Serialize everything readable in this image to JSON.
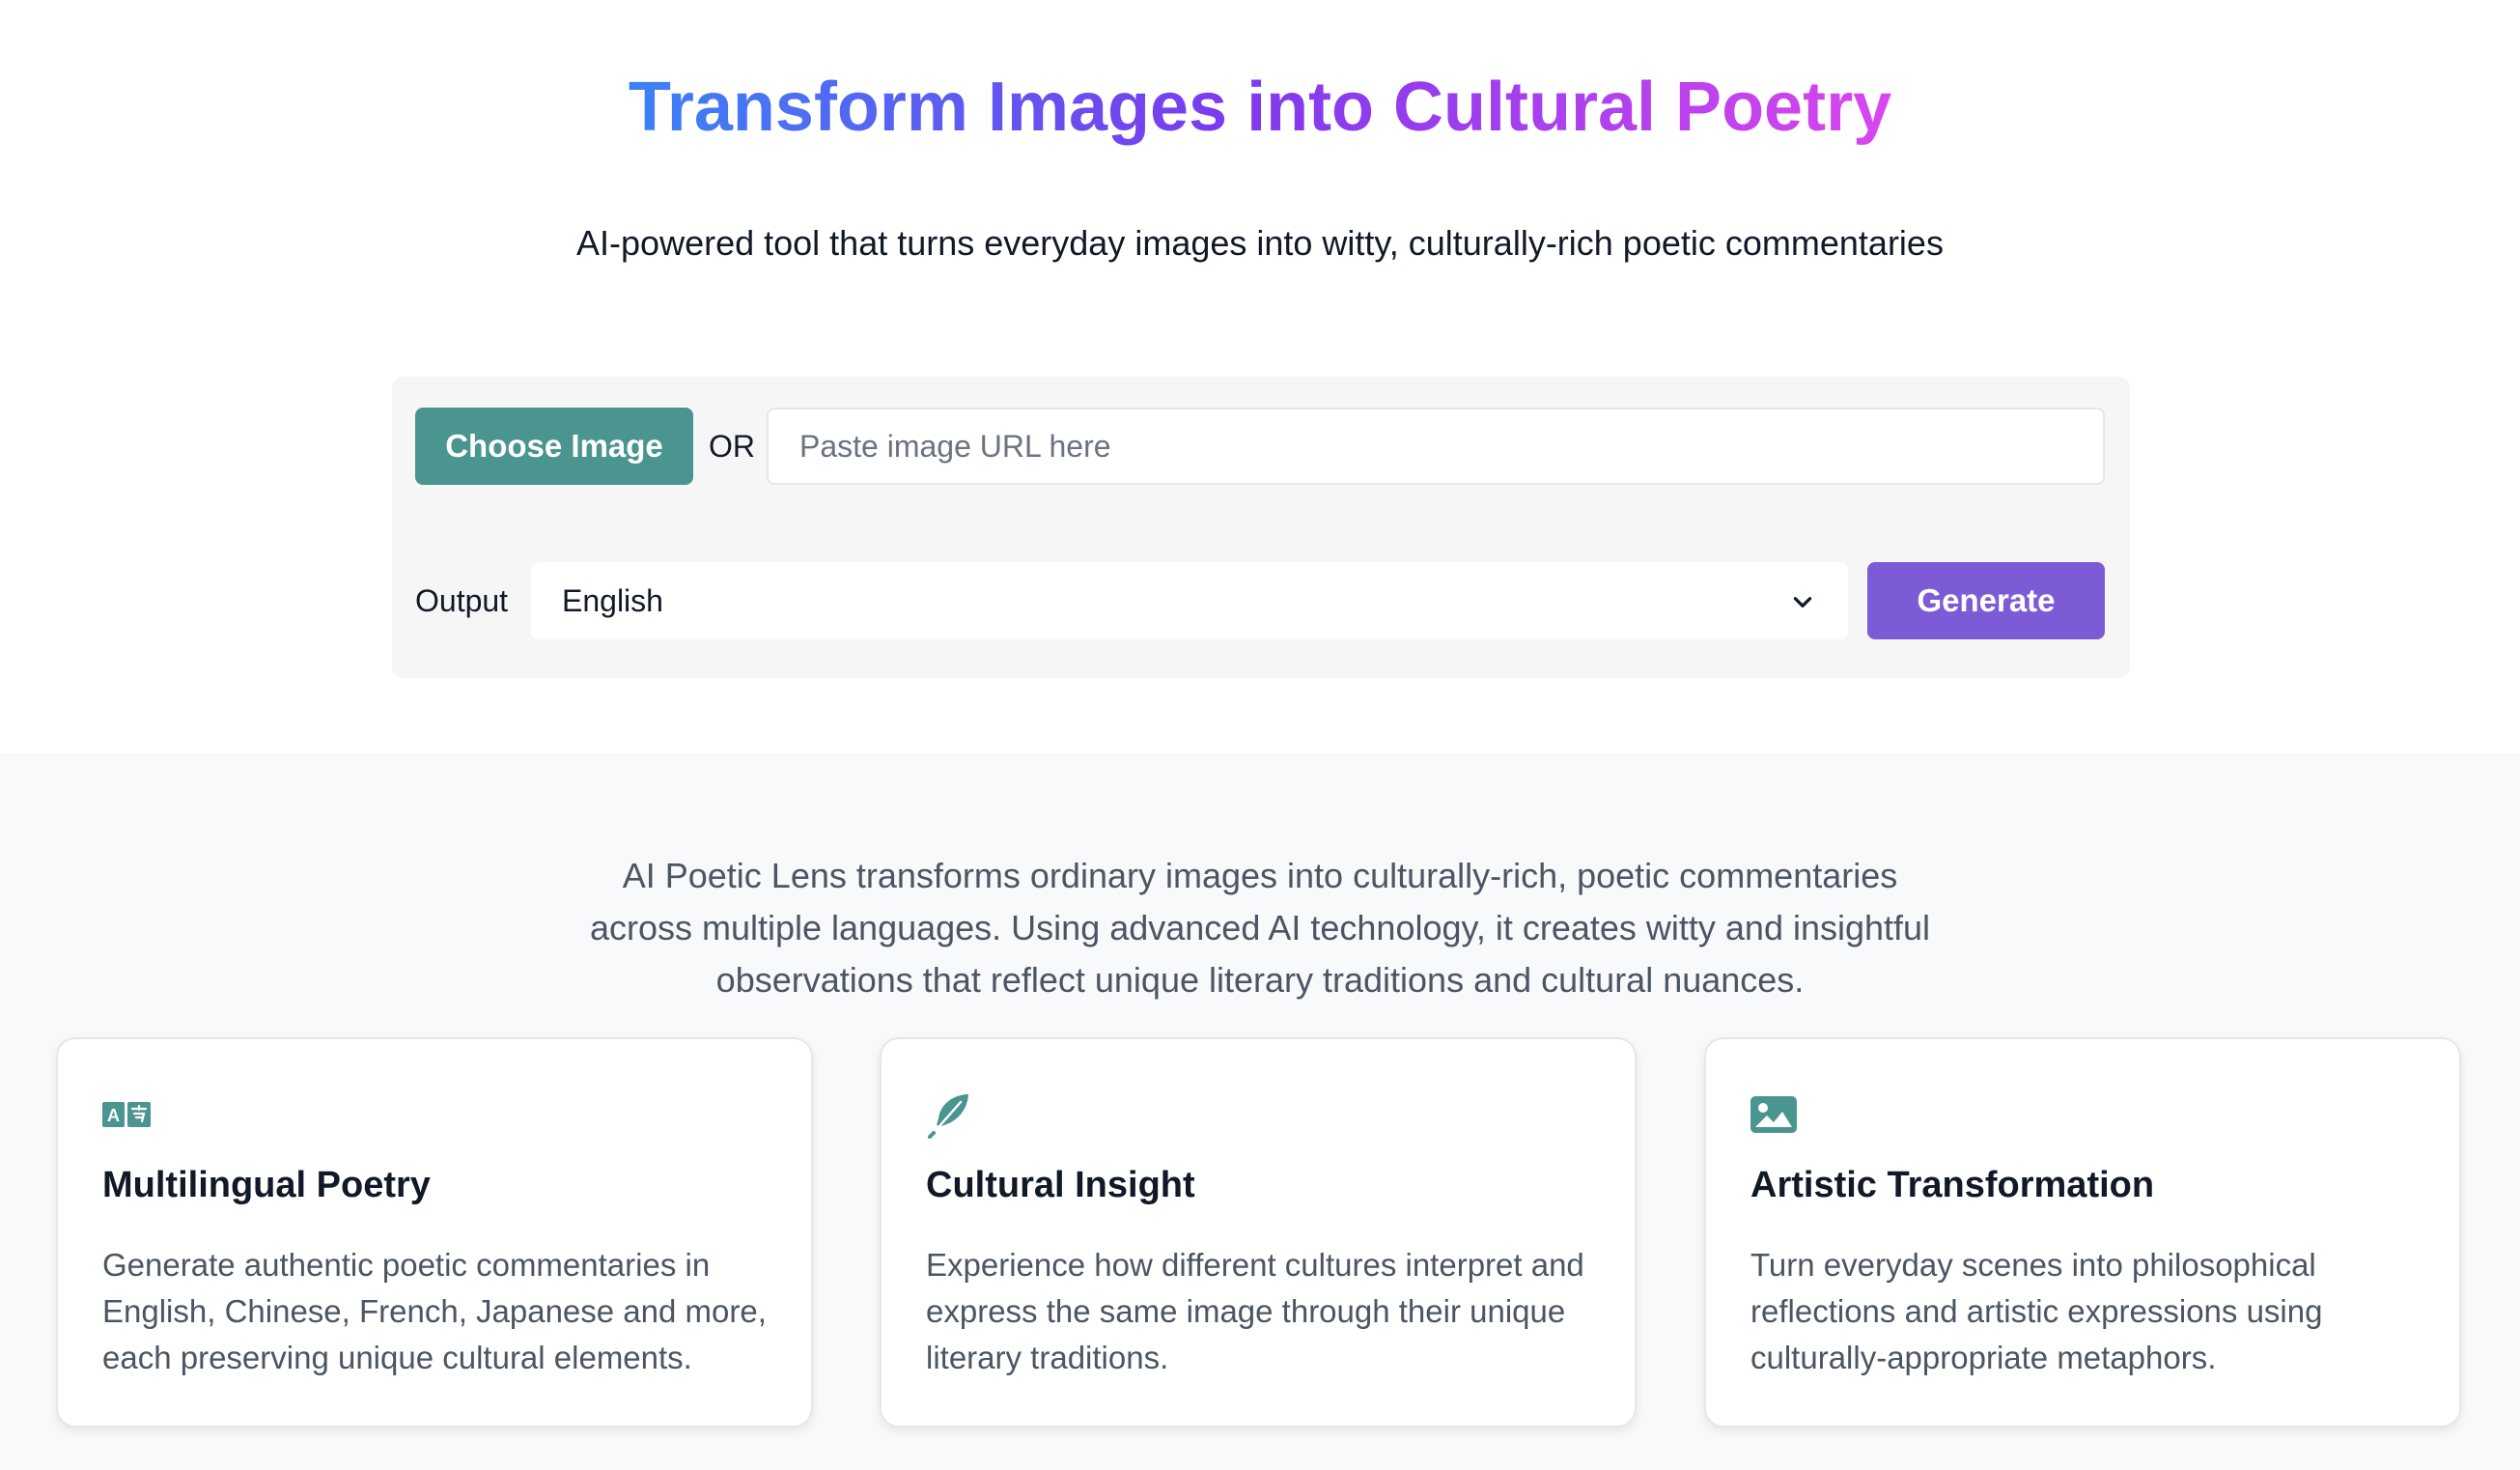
{
  "header": {
    "title": "Transform Images into Cultural Poetry",
    "subtitle": "AI-powered tool that turns everyday images into witty, culturally-rich poetic commentaries"
  },
  "form": {
    "choose_label": "Choose Image",
    "or_label": "OR",
    "url_placeholder": "Paste image URL here",
    "url_value": "",
    "output_label": "Output",
    "language_selected": "English",
    "generate_label": "Generate"
  },
  "about": {
    "text": "AI Poetic Lens transforms ordinary images into culturally-rich, poetic commentaries across multiple languages. Using advanced AI technology, it creates witty and insightful observations that reflect unique literary traditions and cultural nuances."
  },
  "features": [
    {
      "icon": "translate-icon",
      "title": "Multilingual Poetry",
      "description": "Generate authentic poetic commentaries in English, Chinese, French, Japanese and more, each preserving unique cultural elements."
    },
    {
      "icon": "feather-icon",
      "title": "Cultural Insight",
      "description": "Experience how different cultures interpret and express the same image through their unique literary traditions."
    },
    {
      "icon": "image-icon",
      "title": "Artistic Transformation",
      "description": "Turn everyday scenes into philosophical reflections and artistic expressions using culturally-appropriate metaphors."
    }
  ],
  "colors": {
    "teal": "#4b9590",
    "purple": "#7e5bd6",
    "gradient_start": "#3b82f6",
    "gradient_mid": "#7c3aed",
    "gradient_end": "#d946ef"
  }
}
